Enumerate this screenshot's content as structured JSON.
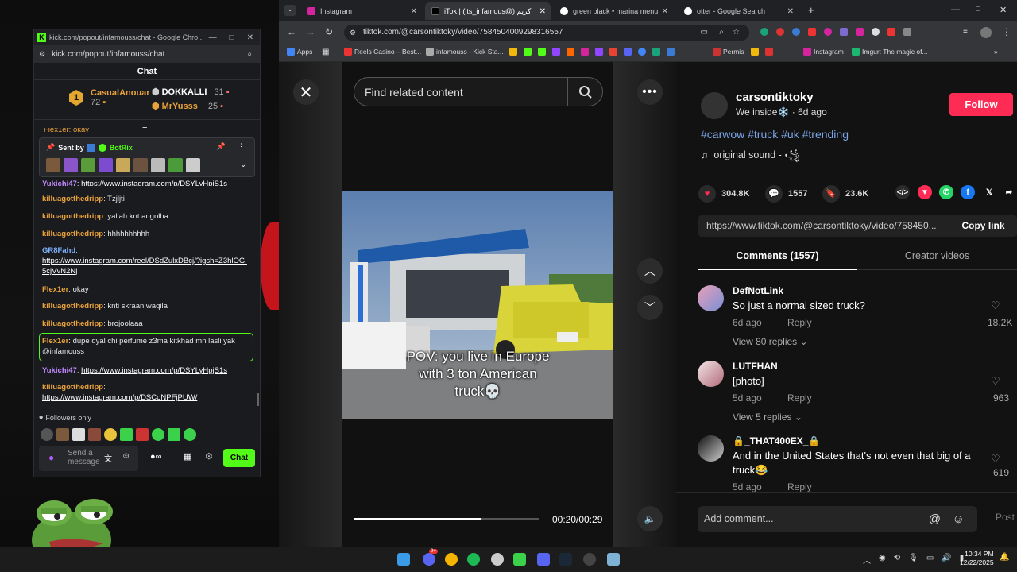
{
  "kick": {
    "window_title": "kick.com/popout/infamouss/chat - Google Chro...",
    "url": "kick.com/popout/infamouss/chat",
    "chat_header": "Chat",
    "leaders": [
      {
        "rank": "1",
        "name": "CasualAnouar",
        "count": "72"
      },
      {
        "name": "DOKKALLI",
        "count": "31"
      },
      {
        "name": "MrYusss",
        "count": "25"
      }
    ],
    "pinned": {
      "label": "Sent by",
      "sender": "BotRix"
    },
    "partial_top": "Flex1er: okay",
    "messages": [
      {
        "user": "Yukichi47",
        "text": "https://www.instagram.com/p/DSYLyHpjS1s"
      },
      {
        "user": "killuagotthedripp",
        "text": "Tzjljti"
      },
      {
        "user": "killuagotthedripp",
        "text": "yallah knt angolha"
      },
      {
        "user": "killuagotthedripp",
        "text": "hhhhhhhhhh"
      },
      {
        "user": "GR8Fahd",
        "text": "https://www.instagram.com/reel/DSdZulxDBcj/?igsh=Z3hlOGI5cjVvN2Nj"
      },
      {
        "user": "Flex1er",
        "text": "okay"
      },
      {
        "user": "killuagotthedripp",
        "text": "knti skraan waqila"
      },
      {
        "user": "killuagotthedripp",
        "text": "brojoolaaa"
      },
      {
        "user": "Flex1er",
        "text": "dupe dyal chi perfume z3ma kitkhad mn lasli yak @infamouss"
      },
      {
        "user": "Yukichi47",
        "text": "https://www.instagram.com/p/DSYLyHpjS1s"
      },
      {
        "user": "killuagotthedripp",
        "text": "https://www.instagram.com/p/DSCoNPFjPUW/"
      }
    ],
    "followers_only": "Followers only",
    "input_placeholder": "Send a message",
    "chat_button": "Chat"
  },
  "browser": {
    "tabs": [
      {
        "title": "Instagram"
      },
      {
        "title": "iTok | (its_infamous@) کریم"
      },
      {
        "title": "green black • marina menu - G"
      },
      {
        "title": "otter - Google Search"
      }
    ],
    "url": "tiktok.com/@carsontiktoky/video/7584504009298316557",
    "bookmarks": [
      "Apps",
      "Reels Casino – Best...",
      "infamouss - Kick Sta...",
      "Permis",
      "Instagram",
      "Imgur: The magic of..."
    ]
  },
  "tiktok": {
    "search_placeholder": "Find related content",
    "caption_line1": "POV: you live in Europe",
    "caption_line2": "with 3 ton American",
    "caption_line3": "truck💀",
    "progress": 0.69,
    "time": "00:20/00:29",
    "author": "carsontiktoky",
    "author_meta": "We inside❄️ · 6d ago",
    "follow": "Follow",
    "hashtags": "#carwow #truck #uk #trending",
    "sound": "original sound - ꧁",
    "likes": "304.8K",
    "comments_count": "1557",
    "saves": "23.6K",
    "share_link": "https://www.tiktok.com/@carsontiktoky/video/758450...",
    "copy_link": "Copy link",
    "tab_comments": "Comments (1557)",
    "tab_creator": "Creator videos",
    "comments": [
      {
        "name": "DefNotLink",
        "text": "So just a normal sized truck?",
        "date": "6d ago",
        "reply": "Reply",
        "views": "View 80 replies",
        "likes": "18.2K"
      },
      {
        "name": "LUTFHAN",
        "text": "[photo]",
        "date": "5d ago",
        "reply": "Reply",
        "views": "View 5 replies",
        "likes": "963"
      },
      {
        "name": "🔒_THAT400EX_🔒",
        "text": "And in the United States that's not even that big of a truck😂",
        "date": "5d ago",
        "reply": "Reply",
        "likes": "619"
      }
    ],
    "add_comment": "Add comment...",
    "post": "Post"
  },
  "taskbar": {
    "time": "10:34 PM",
    "date": "12/22/2025",
    "badge": "9+"
  }
}
